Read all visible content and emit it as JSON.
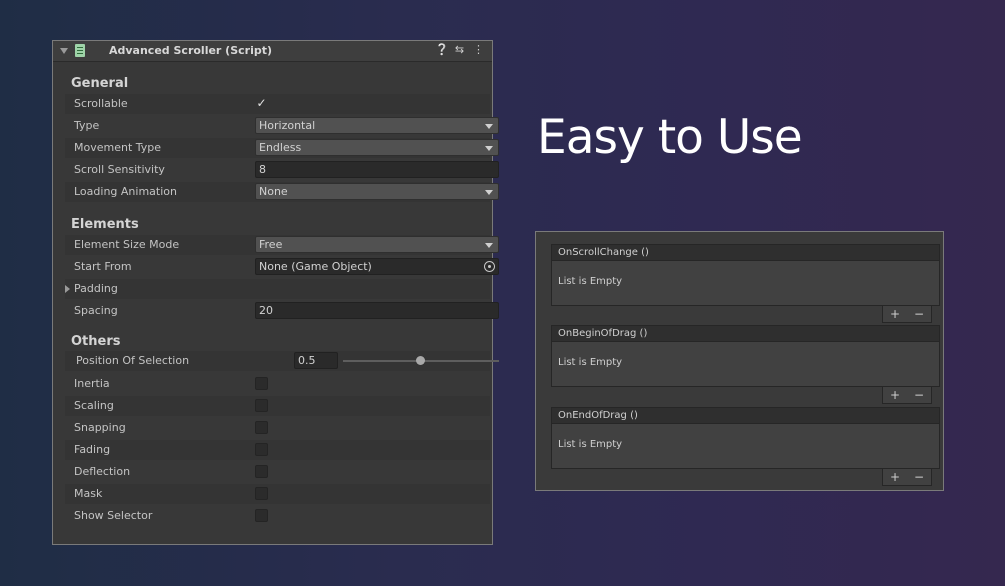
{
  "header": {
    "title": "Advanced Scroller (Script)",
    "icons": [
      "help-icon",
      "preset-icon",
      "kebab-menu-icon"
    ]
  },
  "general": {
    "title": "General",
    "scrollable_label": "Scrollable",
    "scrollable_checked": true,
    "type_label": "Type",
    "type_value": "Horizontal",
    "movement_label": "Movement Type",
    "movement_value": "Endless",
    "sensitivity_label": "Scroll Sensitivity",
    "sensitivity_value": "8",
    "loading_label": "Loading Animation",
    "loading_value": "None"
  },
  "elements": {
    "title": "Elements",
    "size_mode_label": "Element Size Mode",
    "size_mode_value": "Free",
    "start_from_label": "Start From",
    "start_from_value": "None (Game Object)",
    "padding_label": "Padding",
    "spacing_label": "Spacing",
    "spacing_value": "20"
  },
  "others": {
    "title": "Others",
    "position_label": "Position Of Selection",
    "position_value": "0.5",
    "toggles": [
      {
        "label": "Inertia",
        "checked": false
      },
      {
        "label": "Scaling",
        "checked": false
      },
      {
        "label": "Snapping",
        "checked": false
      },
      {
        "label": "Fading",
        "checked": false
      },
      {
        "label": "Deflection",
        "checked": false
      },
      {
        "label": "Mask",
        "checked": false
      },
      {
        "label": "Show Selector",
        "checked": false
      }
    ]
  },
  "headline": "Easy to Use",
  "events": [
    {
      "name": "OnScrollChange ()",
      "empty_text": "List is Empty",
      "add": "+",
      "remove": "−"
    },
    {
      "name": "OnBeginOfDrag ()",
      "empty_text": "List is Empty",
      "add": "+",
      "remove": "−"
    },
    {
      "name": "OnEndOfDrag ()",
      "empty_text": "List is Empty",
      "add": "+",
      "remove": "−"
    }
  ]
}
